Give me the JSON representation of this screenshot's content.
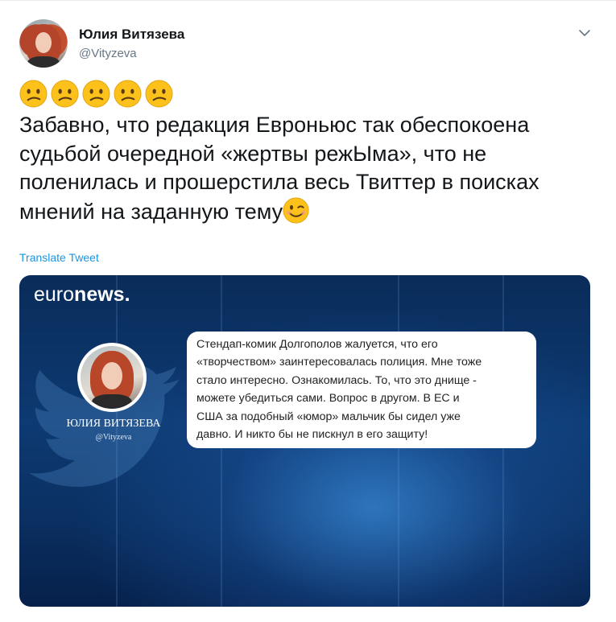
{
  "author": {
    "display_name": "Юлия Витязева",
    "handle": "@Vityzeva"
  },
  "tweet": {
    "emoji_prefix": [
      "confused-face",
      "confused-face",
      "confused-face",
      "confused-face",
      "confused-face"
    ],
    "text_lines": [
      "Забавно, что редакция Евроньюс так обеспокоена",
      "судьбой очередной «жертвы режЫма», что не",
      "поленилась и прошерстила весь Твиттер в поисках",
      "мнений на заданную тему"
    ],
    "emoji_suffix": "winking-face",
    "translate_label": "Translate Tweet"
  },
  "media": {
    "logo_light": "euro",
    "logo_bold": "news.",
    "quoted_name": "ЮЛИЯ ВИТЯЗЕВА",
    "quoted_handle": "@Vityzeva",
    "quote_lines": [
      "Стендап-комик Долгополов жалуется, что его",
      "«творчеством» заинтересовалась полиция. Мне тоже",
      "стало интересно. Ознакомилась. То, что это днище -",
      "можете убедиться сами. Вопрос в другом. В ЕС и",
      "США за подобный «юмор» мальчик бы сидел уже",
      "давно. И никто бы не пискнул в его защиту!"
    ]
  },
  "colors": {
    "link": "#1b95e0",
    "text": "#14171a",
    "muted": "#657786",
    "emoji": "#fcc21b"
  }
}
